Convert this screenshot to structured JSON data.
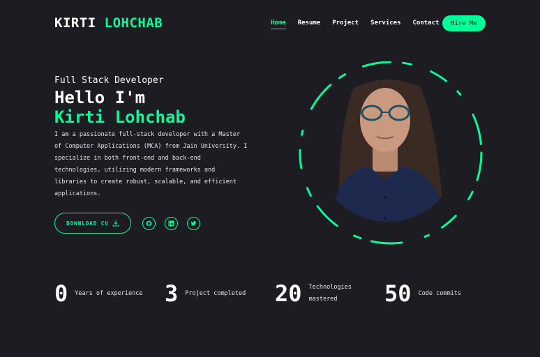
{
  "header": {
    "logo_first": "KIRTI",
    "logo_second": "LOHCHAB",
    "nav": [
      "Home",
      "Resume",
      "Project",
      "Services",
      "Contact"
    ],
    "hire_label": "Hire Me"
  },
  "hero": {
    "role": "Full Stack Developer",
    "greeting": "Hello I'm",
    "name": "Kirti Lohchab",
    "bio": "I am a passionate full-stack developer with a Master of Computer Applications (MCA) from Jain University. I specialize in both front-end and back-end technologies, utilizing modern frameworks and libraries to create robust, scalable, and efficient applications.",
    "cv_label": "DOWNLOAD CV"
  },
  "socials": [
    "github-icon",
    "linkedin-icon",
    "twitter-icon"
  ],
  "stats": [
    {
      "value": "0",
      "label": "Years of experience"
    },
    {
      "value": "3",
      "label": "Project completed"
    },
    {
      "value": "20",
      "label": "Technologies mastered"
    },
    {
      "value": "50",
      "label": "Code commits"
    }
  ],
  "colors": {
    "accent": "#00ff99",
    "background": "#1c1c22"
  }
}
